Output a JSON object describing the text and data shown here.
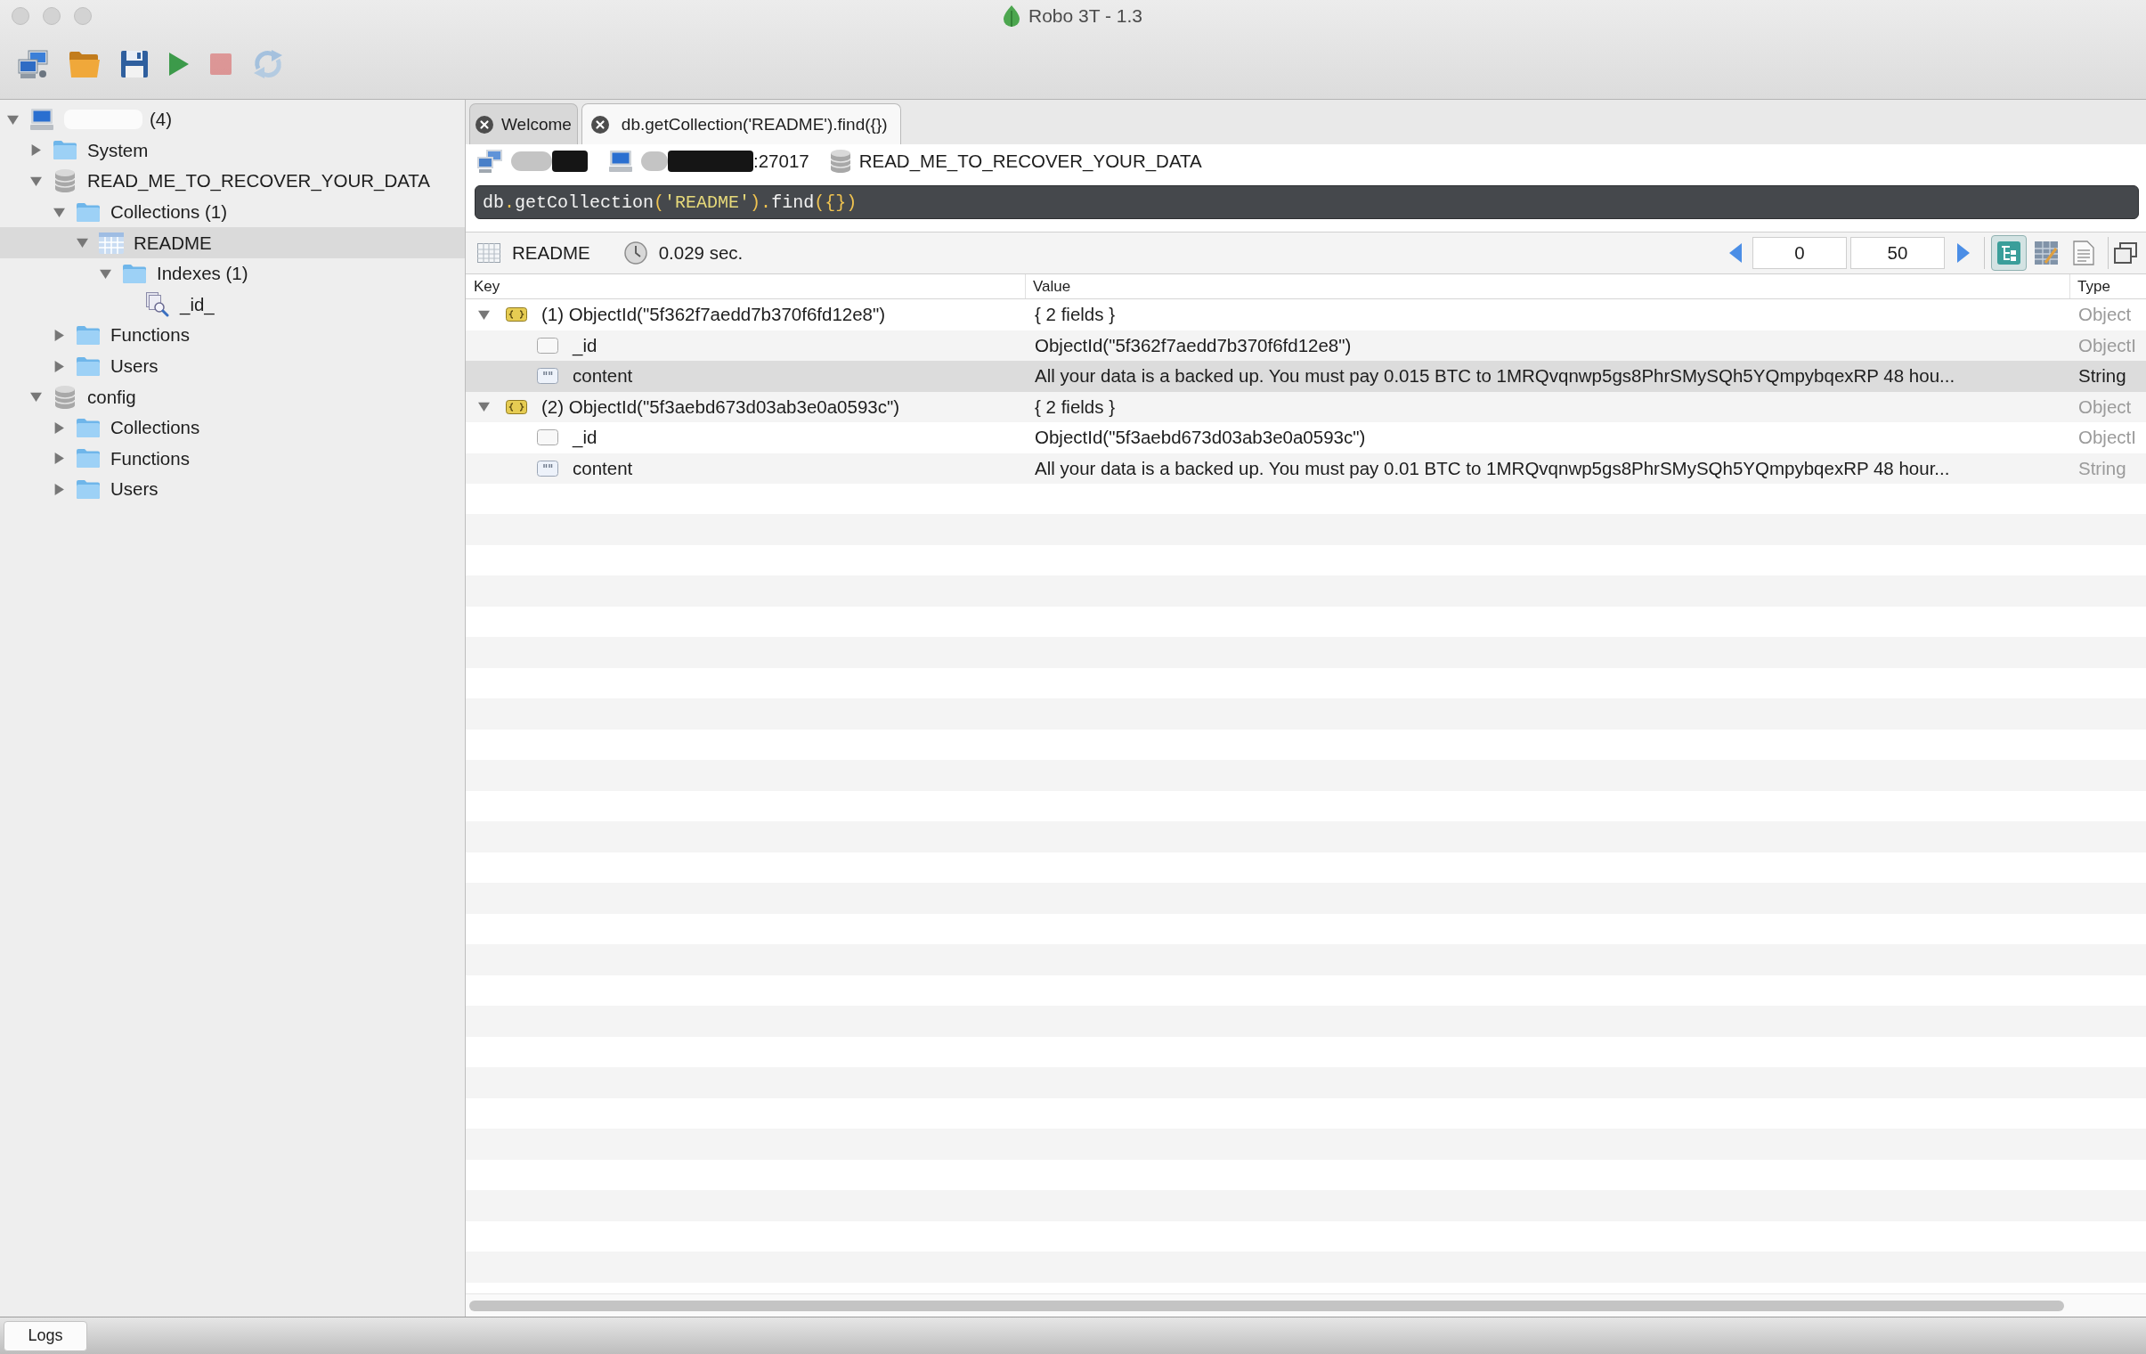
{
  "window": {
    "title": "Robo 3T - 1.3"
  },
  "toolbar": [
    {
      "kind": "connect",
      "disabled": false
    },
    {
      "kind": "open",
      "disabled": false
    },
    {
      "kind": "save",
      "disabled": false
    },
    {
      "kind": "run",
      "disabled": false
    },
    {
      "kind": "stop",
      "disabled": true
    },
    {
      "kind": "rotate",
      "disabled": true
    }
  ],
  "sidebar": {
    "tree": [
      {
        "kind": "server",
        "label": "(4)",
        "redacted": true,
        "expanded": true,
        "selected": false,
        "children": [
          {
            "kind": "folder",
            "label": "System",
            "expanded": false,
            "selected": false
          },
          {
            "kind": "database",
            "label": "READ_ME_TO_RECOVER_YOUR_DATA",
            "expanded": true,
            "selected": false,
            "children": [
              {
                "kind": "folder",
                "label": "Collections (1)",
                "expanded": true,
                "selected": false,
                "children": [
                  {
                    "kind": "collection",
                    "label": "README",
                    "expanded": true,
                    "selected": true,
                    "children": [
                      {
                        "kind": "folder",
                        "label": "Indexes (1)",
                        "expanded": true,
                        "selected": false,
                        "children": [
                          {
                            "kind": "index",
                            "label": "_id_",
                            "selected": false
                          }
                        ]
                      }
                    ]
                  }
                ]
              },
              {
                "kind": "folder",
                "label": "Functions",
                "expanded": false,
                "selected": false
              },
              {
                "kind": "folder",
                "label": "Users",
                "expanded": false,
                "selected": false
              }
            ]
          },
          {
            "kind": "database",
            "label": "config",
            "expanded": true,
            "selected": false,
            "children": [
              {
                "kind": "folder",
                "label": "Collections",
                "expanded": false,
                "selected": false
              },
              {
                "kind": "folder",
                "label": "Functions",
                "expanded": false,
                "selected": false
              },
              {
                "kind": "folder",
                "label": "Users",
                "expanded": false,
                "selected": false
              }
            ]
          }
        ]
      }
    ]
  },
  "tabs": [
    {
      "label": "Welcome",
      "selected": false
    },
    {
      "label": "db.getCollection('README').find({})",
      "selected": true
    }
  ],
  "connection_bar": [
    {
      "kind": "connection",
      "redacted": true
    },
    {
      "kind": "server",
      "label": ":27017",
      "redacted": true
    },
    {
      "kind": "database",
      "label": "READ_ME_TO_RECOVER_YOUR_DATA",
      "redacted": false
    }
  ],
  "query": "db.getCollection('README').find({})",
  "results_toolbar": {
    "collection": "README",
    "time": "0.029 sec.",
    "skip": "0",
    "limit": "50",
    "view_modes": [
      {
        "kind": "tree",
        "selected": true
      },
      {
        "kind": "table",
        "selected": false
      },
      {
        "kind": "text",
        "selected": false
      }
    ]
  },
  "table": {
    "columns": [
      "Key",
      "Value",
      "Type"
    ],
    "rows": [
      {
        "kind": "document",
        "key": "(1) ObjectId(\"5f362f7aedd7b370f6fd12e8\")",
        "value": "{ 2 fields }",
        "type": "Object",
        "expanded": true,
        "selected": false,
        "children": [
          {
            "kind": "objectid",
            "key": "_id",
            "value": "ObjectId(\"5f362f7aedd7b370f6fd12e8\")",
            "type": "ObjectI",
            "selected": false
          },
          {
            "kind": "string",
            "key": "content",
            "value": "All your data is a backed up. You must pay 0.015 BTC to 1MRQvqnwp5gs8PhrSMySQh5YQmpybqexRP 48 hou...",
            "type": "String",
            "selected": true
          }
        ]
      },
      {
        "kind": "document",
        "key": "(2) ObjectId(\"5f3aebd673d03ab3e0a0593c\")",
        "value": "{ 2 fields }",
        "type": "Object",
        "expanded": true,
        "selected": false,
        "children": [
          {
            "kind": "objectid",
            "key": "_id",
            "value": "ObjectId(\"5f3aebd673d03ab3e0a0593c\")",
            "type": "ObjectI",
            "selected": false
          },
          {
            "kind": "string",
            "key": "content",
            "value": "All your data is a backed up. You must pay 0.01 BTC to 1MRQvqnwp5gs8PhrSMySQh5YQmpybqexRP 48 hour...",
            "type": "String",
            "selected": false
          }
        ]
      }
    ]
  },
  "status_bar": {
    "logs_button": "Logs"
  }
}
